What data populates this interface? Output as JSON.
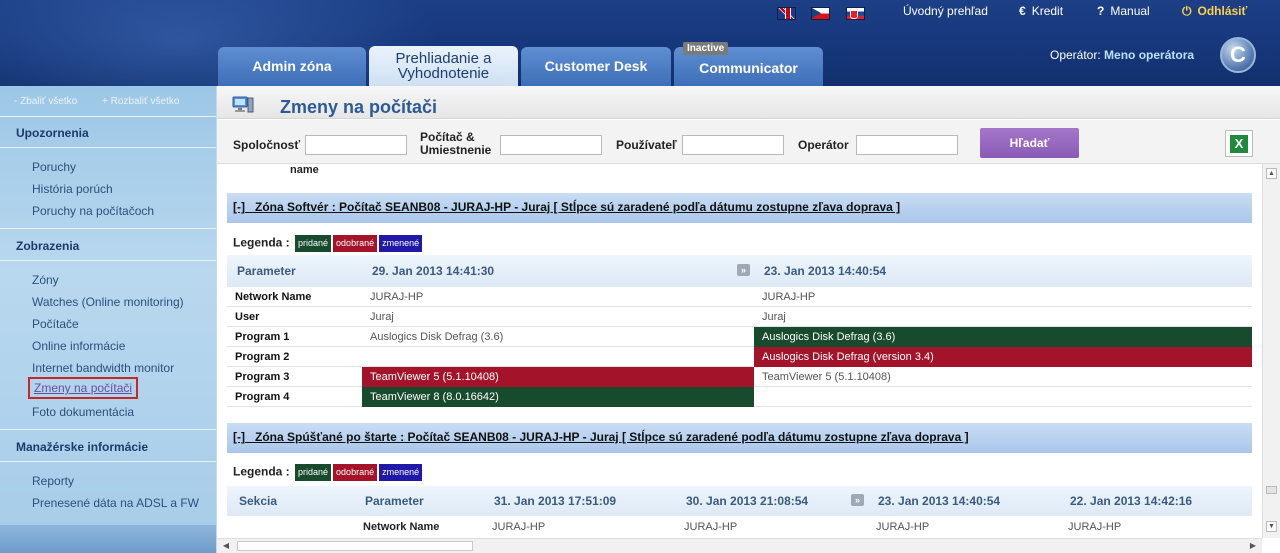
{
  "header": {
    "links": {
      "overview": "Úvodný prehľad",
      "credit": "Kredit",
      "manual": "Manual",
      "logout": "Odhlásiť"
    },
    "icons": {
      "credit": "€",
      "manual": "?",
      "logout": "⏻"
    },
    "tabs": [
      {
        "line1": "Admin zóna",
        "line2": ""
      },
      {
        "line1": "Prehliadanie a",
        "line2": "Vyhodnotenie"
      },
      {
        "line1": "Customer Desk",
        "line2": ""
      },
      {
        "line1": "Communicator",
        "line2": ""
      }
    ],
    "inactive_badge": "Inactive",
    "operator_label": "Operátor:",
    "operator_name": "Meno operátora",
    "logo_letter": "C"
  },
  "sidebar": {
    "collapse_all": "Zbaliť všetko",
    "expand_all": "Rozbaliť všetko",
    "sections": [
      {
        "title": "Upozornenia",
        "items": [
          "Poruchy",
          "História porúch",
          "Poruchy na počítačoch"
        ]
      },
      {
        "title": "Zobrazenia",
        "items": [
          "Zóny",
          "Watches (Online monitoring)",
          "Počítače",
          "Online informácie",
          "Internet bandwidth monitor",
          "Zmeny na počítači",
          "Foto dokumentácia"
        ]
      },
      {
        "title": "Manažérske informácie",
        "items": [
          "Reporty",
          "Prenesené dáta na ADSL a FW"
        ]
      }
    ]
  },
  "page": {
    "title": "Zmeny na počítači",
    "filters": {
      "company": "Spoločnosť",
      "computer_l1": "Počítač &",
      "computer_l2": "Umiestnenie",
      "user": "Používateľ",
      "operator": "Operátor",
      "search_button": "Hľadať"
    },
    "cut_text": "name",
    "legend_label": "Legenda :",
    "legend": {
      "added": "pridané",
      "removed": "odobrané",
      "changed": "zmenené"
    },
    "zone1": {
      "toggle": "[-]",
      "title": "Zóna Softvér : Počítač SEANB08 - JURAJ-HP - Juraj [ Stĺpce sú zaradené podľa dátumu zostupne zľava doprava ]",
      "col_param": "Parameter",
      "date1": "29. Jan 2013 14:41:30",
      "date2": "23. Jan 2013 14:40:54",
      "rows": [
        {
          "k": "Network Name",
          "v1": "JURAJ-HP",
          "v2": "JURAJ-HP"
        },
        {
          "k": "User",
          "v1": "Juraj",
          "v2": "Juraj"
        },
        {
          "k": "Program 1",
          "v1": "Auslogics Disk Defrag (3.6)",
          "v2": "Auslogics Disk Defrag (3.6)"
        },
        {
          "k": "Program 2",
          "v1": "",
          "v2": "Auslogics Disk Defrag (version 3.4)"
        },
        {
          "k": "Program 3",
          "v1": "TeamViewer 5 (5.1.10408)",
          "v2": "TeamViewer 5 (5.1.10408)"
        },
        {
          "k": "Program 4",
          "v1": "TeamViewer 8 (8.0.16642)",
          "v2": ""
        }
      ]
    },
    "zone2": {
      "toggle": "[-]",
      "title": "Zóna Spúšťané po štarte : Počítač SEANB08 - JURAJ-HP - Juraj [ Stĺpce sú zaradené podľa dátumu zostupne zľava doprava ]",
      "col_section": "Sekcia",
      "col_param": "Parameter",
      "dates": [
        "31. Jan 2013 17:51:09",
        "30. Jan 2013 21:08:54",
        "23. Jan 2013 14:40:54",
        "22. Jan 2013 14:42:16"
      ],
      "row": {
        "k": "Network Name",
        "vals": [
          "JURAJ-HP",
          "JURAJ-HP",
          "JURAJ-HP",
          "JURAJ-HP"
        ]
      }
    },
    "swap_icon": "»"
  },
  "colors": {
    "added": "#184a2e",
    "removed": "#a3142a",
    "changed": "#2019a8",
    "accent": "#2c5a94"
  }
}
